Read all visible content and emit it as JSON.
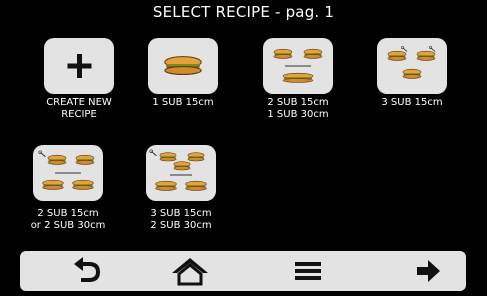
{
  "header": {
    "title": "SELECT RECIPE - pag. 1"
  },
  "recipes": [
    {
      "icon": "plus-icon",
      "line1": "CREATE NEW",
      "line2": "RECIPE"
    },
    {
      "icon": "single-sub-icon",
      "line1": "1 SUB 15cm",
      "line2": ""
    },
    {
      "icon": "two-plus-one-sub-icon",
      "line1": "2 SUB 15cm",
      "line2": "1 SUB 30cm"
    },
    {
      "icon": "three-sub-icon",
      "line1": "3 SUB 15cm",
      "line2": ""
    },
    {
      "icon": "two-or-two-sub-icon",
      "line1": "2 SUB 15cm",
      "line2": "or 2 SUB 30cm"
    },
    {
      "icon": "three-plus-two-sub-icon",
      "line1": "3 SUB 15cm",
      "line2": "2 SUB 30cm"
    }
  ],
  "navbar": {
    "buttons": [
      "back-arrow-icon",
      "home-icon",
      "menu-icon",
      "next-arrow-icon"
    ]
  },
  "colors": {
    "background": "#000000",
    "tile": "#e3e3e3",
    "bread": "#e6a13a",
    "filling": "#7a4a20",
    "lettuce": "#6b8e23",
    "icon": "#111111"
  }
}
